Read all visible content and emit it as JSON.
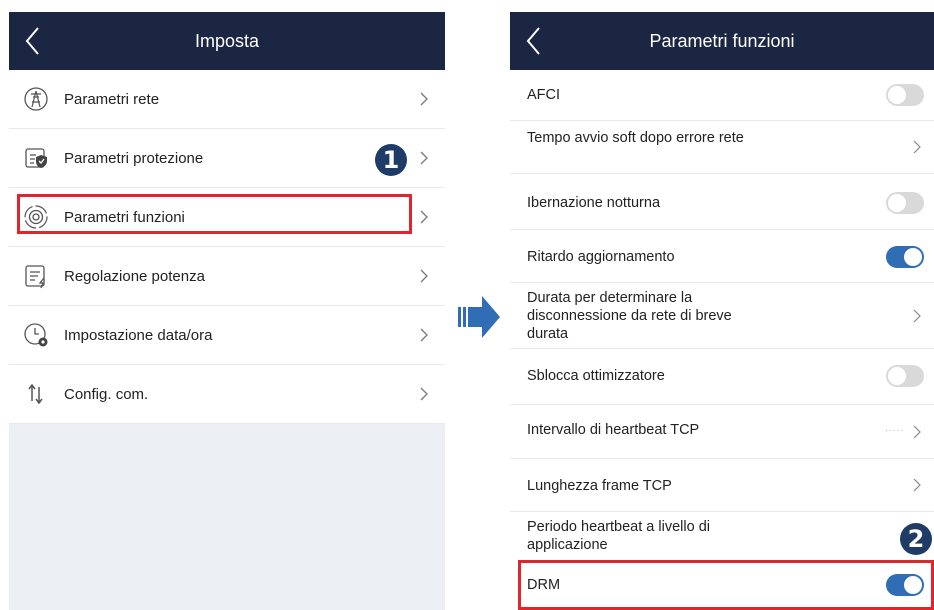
{
  "left_screen": {
    "title": "Imposta",
    "items": [
      {
        "label": "Parametri rete",
        "icon": "grid-tower-icon"
      },
      {
        "label": "Parametri protezione",
        "icon": "protection-shield-icon"
      },
      {
        "label": "Parametri funzioni",
        "icon": "function-dial-icon"
      },
      {
        "label": "Regolazione potenza",
        "icon": "power-document-icon"
      },
      {
        "label": "Impostazione data/ora",
        "icon": "clock-gear-icon"
      },
      {
        "label": "Config. com.",
        "icon": "transfer-arrows-icon"
      }
    ]
  },
  "right_screen": {
    "title": "Parametri funzioni",
    "items": [
      {
        "label": "AFCI",
        "control": "toggle",
        "state": "off"
      },
      {
        "label": "Tempo avvio soft dopo errore rete",
        "control": "chevron"
      },
      {
        "label": "Ibernazione notturna",
        "control": "toggle",
        "state": "off"
      },
      {
        "label": "Ritardo aggiornamento",
        "control": "toggle",
        "state": "on"
      },
      {
        "label": "Durata per determinare la disconnessione da rete di breve durata",
        "control": "chevron"
      },
      {
        "label": "Sblocca ottimizzatore",
        "control": "toggle",
        "state": "off"
      },
      {
        "label": "Intervallo di heartbeat TCP",
        "control": "chevron",
        "value_hint": "....."
      },
      {
        "label": "Lunghezza frame TCP",
        "control": "chevron"
      },
      {
        "label": "Periodo heartbeat a livello di applicazione",
        "control": "none"
      },
      {
        "label": "DRM",
        "control": "toggle",
        "state": "on"
      }
    ]
  },
  "annotations": {
    "step1": "1",
    "step2": "2"
  },
  "colors": {
    "header_bg": "#1b2643",
    "highlight": "#e0262c",
    "toggle_on": "#2f6db5",
    "badge": "#1f3c67",
    "arrow": "#2f6db5"
  }
}
